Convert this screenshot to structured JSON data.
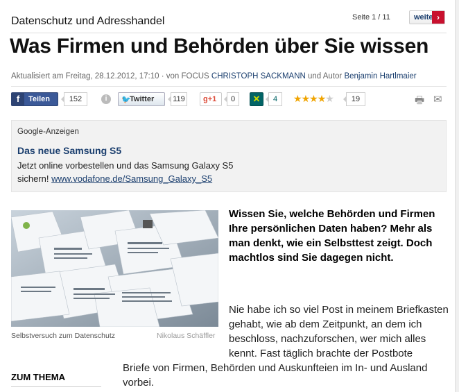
{
  "header": {
    "kicker": "Datenschutz und Adresshandel",
    "pager": "Seite 1 / 11",
    "next_label": "weiter",
    "headline": "Was Firmen und Behörden über Sie wissen"
  },
  "meta": {
    "updated": "Aktualisiert am Freitag, 28.12.2012, 17:10 · von FOCUS ",
    "author1": "CHRISTOPH SACKMANN",
    "and_author": " und Autor ",
    "author2": "Benjamin Hartlmaier"
  },
  "social": {
    "facebook_label": "Teilen",
    "facebook_count": "152",
    "info_icon": "i",
    "twitter_label": "Twitter",
    "twitter_count": "119",
    "gplus_label": "g+1",
    "gplus_count": "0",
    "xing_count": "4",
    "rating_stars": 4,
    "rating_max": 5,
    "rating_count": "19",
    "icons": [
      "facebook-icon",
      "info-icon",
      "twitter-icon",
      "google-plus-icon",
      "xing-icon",
      "star-icon",
      "print-icon",
      "mail-icon"
    ]
  },
  "ad": {
    "label": "Google-Anzeigen",
    "title": "Das neue Samsung S5",
    "text1": "Jetzt online vorbestellen und das Samsung Galaxy S5",
    "text2": "sichern! ",
    "link": "www.vodafone.de/Samsung_Galaxy_S5"
  },
  "image": {
    "caption": "Selbstversuch zum Datenschutz",
    "credit": "Nikolaus Schäffler"
  },
  "article": {
    "lead": "Wissen Sie, welche Behörden und Firmen Ihre persönlichen Daten haben? Mehr als man denkt, wie ein Selbsttest zeigt. Doch machtlos sind Sie dagegen nicht.",
    "body1": "Nie habe ich so viel Post in meinem Briefkasten gehabt, wie ab dem Zeitpunkt, an dem ich beschloss, nachzuforschen, wer mich alles kennt. Fast täglich brachte der Postbote",
    "body2": "Briefe von Firmen, Behörden und Auskunfteien im In- und Ausland vorbei."
  },
  "sidebar": {
    "zum_thema": "ZUM THEMA"
  },
  "colors": {
    "link": "#1a3e6e",
    "accent_red": "#c8102e",
    "facebook": "#3b5998",
    "xing": "#026466",
    "star": "#f0a400"
  }
}
